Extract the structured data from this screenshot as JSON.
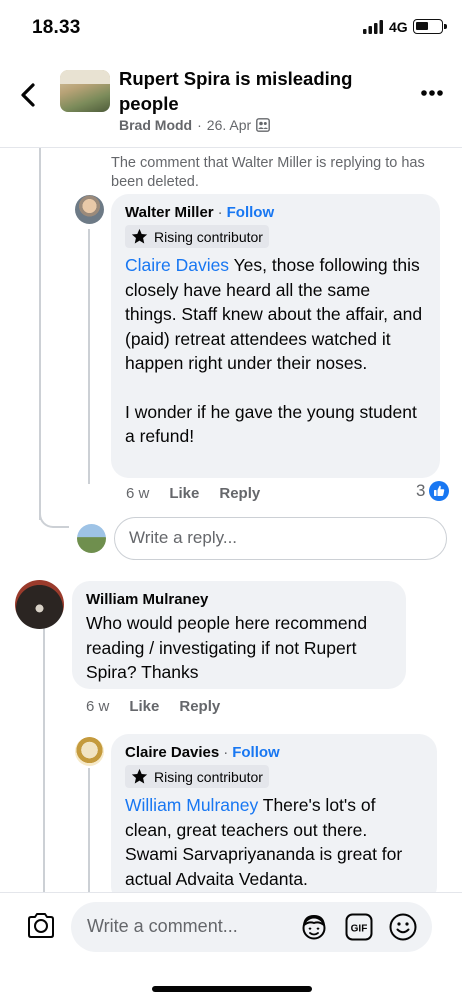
{
  "status_bar": {
    "time": "18.33",
    "network": "4G"
  },
  "header": {
    "title": "Rupert Spira is misleading people",
    "author": "Brad Modd",
    "date": "26. Apr",
    "separator": "·"
  },
  "thread": {
    "deleted_note": "The comment that Walter Miller is replying to has been deleted.",
    "comments": [
      {
        "author": "Walter Miller",
        "separator": "·",
        "follow_label": "Follow",
        "badge": "Rising contributor",
        "mention": "Claire Davies",
        "text_1": " Yes, those following this closely have heard all the same things. Staff knew about the affair, and (paid) retreat attendees watched it happen right under their noses.",
        "text_2": "I wonder if he gave the young student a refund!",
        "time": "6 w",
        "like_label": "Like",
        "reply_label": "Reply",
        "reaction_count": "3"
      },
      {
        "author": "William Mulraney",
        "text": "Who would people here recommend reading / investigating if not Rupert Spira? Thanks",
        "time": "6 w",
        "like_label": "Like",
        "reply_label": "Reply"
      },
      {
        "author": "Claire Davies",
        "separator": "·",
        "follow_label": "Follow",
        "badge": "Rising contributor",
        "mention": "William Mulraney",
        "text": " There's lot's of clean, great teachers out there. Swami Sarvapriyananda is great for actual Advaita Vedanta."
      }
    ],
    "reply_placeholder": "Write a reply..."
  },
  "composer": {
    "placeholder": "Write a comment..."
  },
  "colors": {
    "accent": "#1877f2",
    "bubble": "#f0f2f5",
    "muted": "#65676b"
  },
  "icons": [
    "back-icon",
    "more-icon",
    "members-icon",
    "star-icon",
    "like-icon",
    "camera-icon",
    "avatar-sticker-icon",
    "gif-icon",
    "emoji-icon"
  ]
}
